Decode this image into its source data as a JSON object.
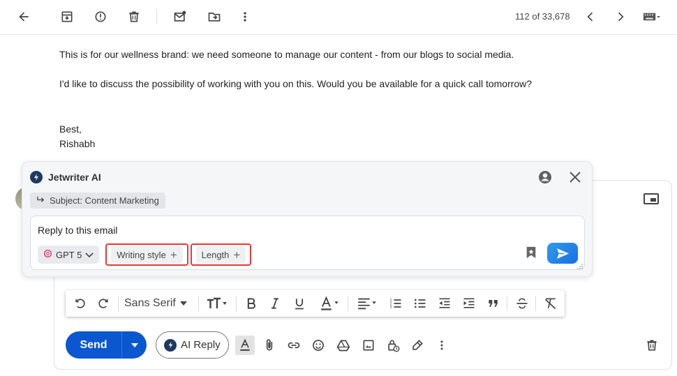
{
  "toolbar": {
    "icons": [
      "back-arrow-icon",
      "archive-icon",
      "report-spam-icon",
      "delete-icon",
      "mark-unread-icon",
      "move-to-icon",
      "more-vert-icon",
      "prev-icon",
      "next-icon",
      "keyboard-icon"
    ],
    "counter": "112 of 33,678"
  },
  "email": {
    "line1": "This is for our wellness brand: we need someone to manage our content - from our blogs to social media.",
    "line2": "I'd like to discuss the possibility of working with you on this. Would you be available for a quick call tomorrow?",
    "signoff": "Best,",
    "signature": "Rishabh"
  },
  "jetwriter": {
    "title": "Jetwriter AI",
    "subject_chip": "Subject: Content Marketing",
    "prompt": "Reply to this email",
    "model": "GPT 5",
    "writing_style": "Writing style",
    "length": "Length",
    "plus": "+",
    "accent": "#e53935"
  },
  "format_bar": {
    "font": "Sans Serif"
  },
  "compose": {
    "send_label": "Send",
    "ai_reply_label": "AI Reply",
    "send_color": "#0b57d0"
  }
}
